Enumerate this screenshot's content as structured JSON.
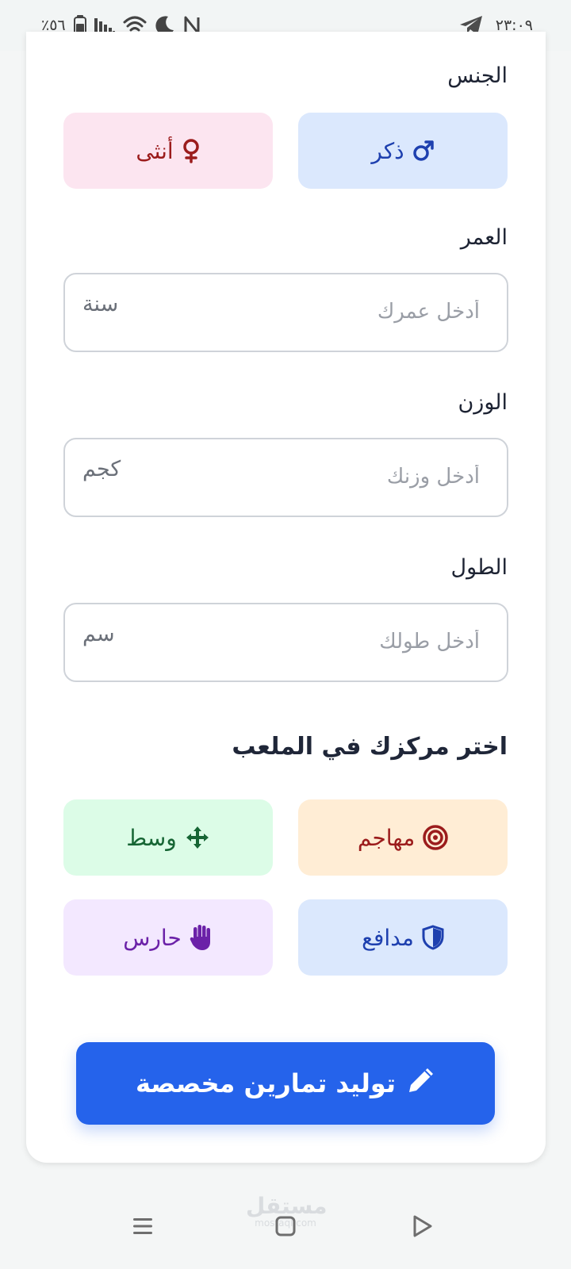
{
  "status_bar": {
    "time": "٢٣:٠٩",
    "battery_percent": "٪٥٦",
    "icons": [
      "telegram-icon",
      "battery-icon",
      "signal-icon",
      "wifi-icon",
      "moon-icon",
      "nfc-icon"
    ]
  },
  "form": {
    "gender": {
      "label": "الجنس",
      "male_label": "ذكر",
      "female_label": "أنثى",
      "male_icon": "male-symbol-icon",
      "female_icon": "female-symbol-icon"
    },
    "age": {
      "label": "العمر",
      "placeholder": "أدخل عمرك",
      "value": "",
      "unit": "سنة"
    },
    "weight": {
      "label": "الوزن",
      "placeholder": "أدخل وزنك",
      "value": "",
      "unit": "كجم"
    },
    "height": {
      "label": "الطول",
      "placeholder": "أدخل طولك",
      "value": "",
      "unit": "سم"
    },
    "position": {
      "title": "اختر مركزك في الملعب",
      "options": [
        {
          "label": "مهاجم",
          "icon": "target-icon"
        },
        {
          "label": "وسط",
          "icon": "arrows-move-icon"
        },
        {
          "label": "مدافع",
          "icon": "shield-icon"
        },
        {
          "label": "حارس",
          "icon": "hand-icon"
        }
      ]
    },
    "generate_button": {
      "label": "توليد تمارين مخصصة",
      "icon": "pen-icon"
    }
  },
  "colors": {
    "primary": "#2563eb",
    "male_bg": "#dbe8fd",
    "male_fg": "#1e40af",
    "female_bg": "#fce5f0",
    "female_fg": "#9b1c1c",
    "attacker_bg": "#ffedd5",
    "attacker_fg": "#9b1c1c",
    "midfield_bg": "#dcfce7",
    "midfield_fg": "#166534",
    "defender_bg": "#dbe8fd",
    "defender_fg": "#1e40af",
    "keeper_bg": "#f3e8ff",
    "keeper_fg": "#6b21a8"
  },
  "nav_bar": {
    "watermark": "مستقل",
    "watermark_sub": "mostaql.com",
    "items": [
      "menu-icon",
      "home-square-icon",
      "back-triangle-icon"
    ]
  }
}
